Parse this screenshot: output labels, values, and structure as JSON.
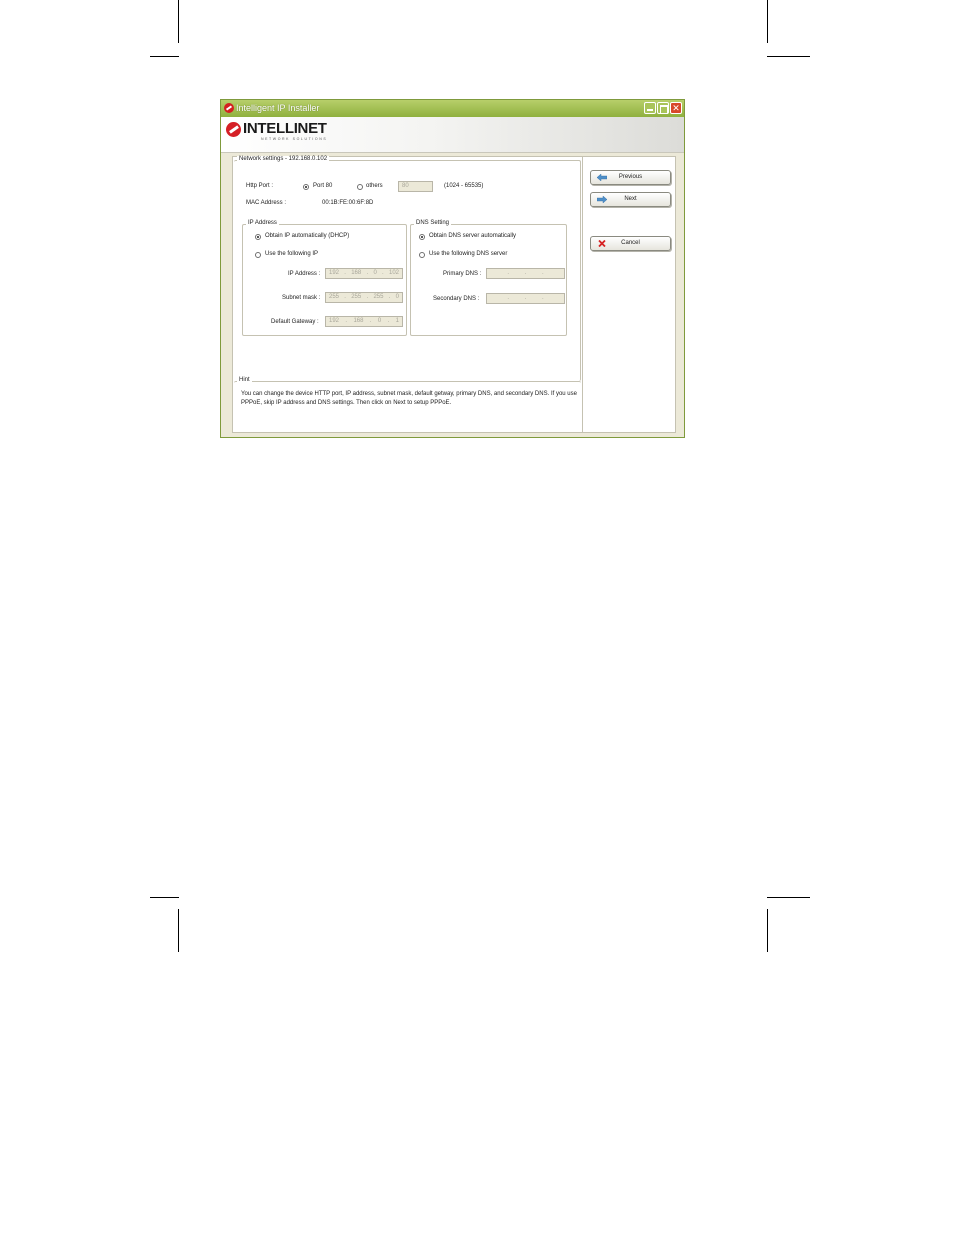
{
  "window": {
    "title": "Intelligent IP Installer",
    "brand": {
      "name": "INTELLINET",
      "tagline": "NETWORK SOLUTIONS"
    }
  },
  "network": {
    "legend": "Network settings - 192.168.0.102",
    "http_port_label": "Http Port :",
    "port80_label": "Port 80",
    "others_label": "others",
    "others_value": "80",
    "port_range": "(1024 - 65535)",
    "mac_label": "MAC Address :",
    "mac_value": "00:1B:FE:00:6F:8D"
  },
  "ip": {
    "legend": "IP Address",
    "auto_label": "Obtain IP automatically (DHCP)",
    "manual_label": "Use the following IP",
    "address_label": "IP Address :",
    "address": [
      "192",
      "168",
      "0",
      "102"
    ],
    "mask_label": "Subnet mask :",
    "mask": [
      "255",
      "255",
      "255",
      "0"
    ],
    "gateway_label": "Default Gateway :",
    "gateway": [
      "192",
      "168",
      "0",
      "1"
    ]
  },
  "dns": {
    "legend": "DNS Setting",
    "auto_label": "Obtain DNS server automatically",
    "manual_label": "Use the following DNS server",
    "primary_label": "Primary DNS :",
    "secondary_label": "Secondary DNS :"
  },
  "hint": {
    "legend": "Hint",
    "text": "You can change the device HTTP port, IP address, subnet mask, default getway, primary DNS, and secondary DNS. If you use PPPoE, skip IP address and DNS settings. Then click on Next to setup PPPoE."
  },
  "buttons": {
    "previous": "Previous",
    "next": "Next",
    "cancel": "Cancel"
  },
  "colors": {
    "titlebar": "#8fb03e",
    "brand_red": "#d51f26",
    "arrow_blue": "#4f8fc8",
    "cancel_red": "#d62222"
  }
}
